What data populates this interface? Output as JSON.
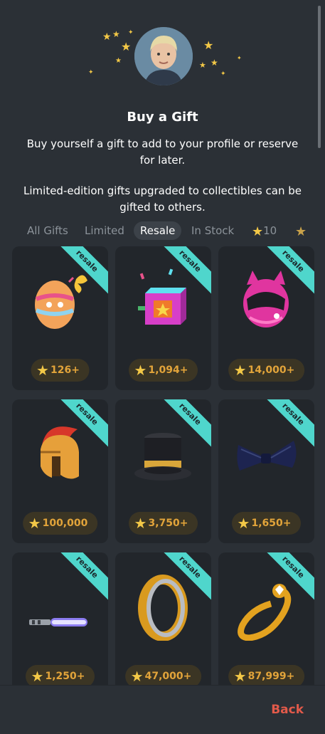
{
  "dialog": {
    "title": "Buy a Gift",
    "description_1": "Buy yourself a gift to add to your profile or reserve for later.",
    "description_2": "Limited-edition gifts upgraded to collectibles can be gifted to others."
  },
  "tabs": [
    {
      "label": "All Gifts"
    },
    {
      "label": "Limited"
    },
    {
      "label": "Resale",
      "active": true
    },
    {
      "label": "In Stock"
    },
    {
      "label": "10",
      "icon": "star-icon"
    }
  ],
  "gifts": [
    {
      "item": "easter-egg",
      "badge": "resale",
      "price": "126+"
    },
    {
      "item": "jack-in-the-box",
      "badge": "resale",
      "price": "1,094+"
    },
    {
      "item": "cat-helmet",
      "badge": "resale",
      "price": "14,000+"
    },
    {
      "item": "spartan-helmet",
      "badge": "resale",
      "price": "100,000"
    },
    {
      "item": "top-hat",
      "badge": "resale",
      "price": "3,750+"
    },
    {
      "item": "bow-tie",
      "badge": "resale",
      "price": "1,650+"
    },
    {
      "item": "light-saber",
      "badge": "resale",
      "price": "1,250+"
    },
    {
      "item": "gold-ring",
      "badge": "resale",
      "price": "47,000+"
    },
    {
      "item": "diamond-ring",
      "badge": "resale",
      "price": "87,999+"
    }
  ],
  "footer": {
    "back_label": "Back"
  },
  "colors": {
    "background": "#2b3036",
    "card": "#22262b",
    "ribbon": "#4fd6cc",
    "price_text": "#e2a43a",
    "back": "#e35a4a"
  }
}
